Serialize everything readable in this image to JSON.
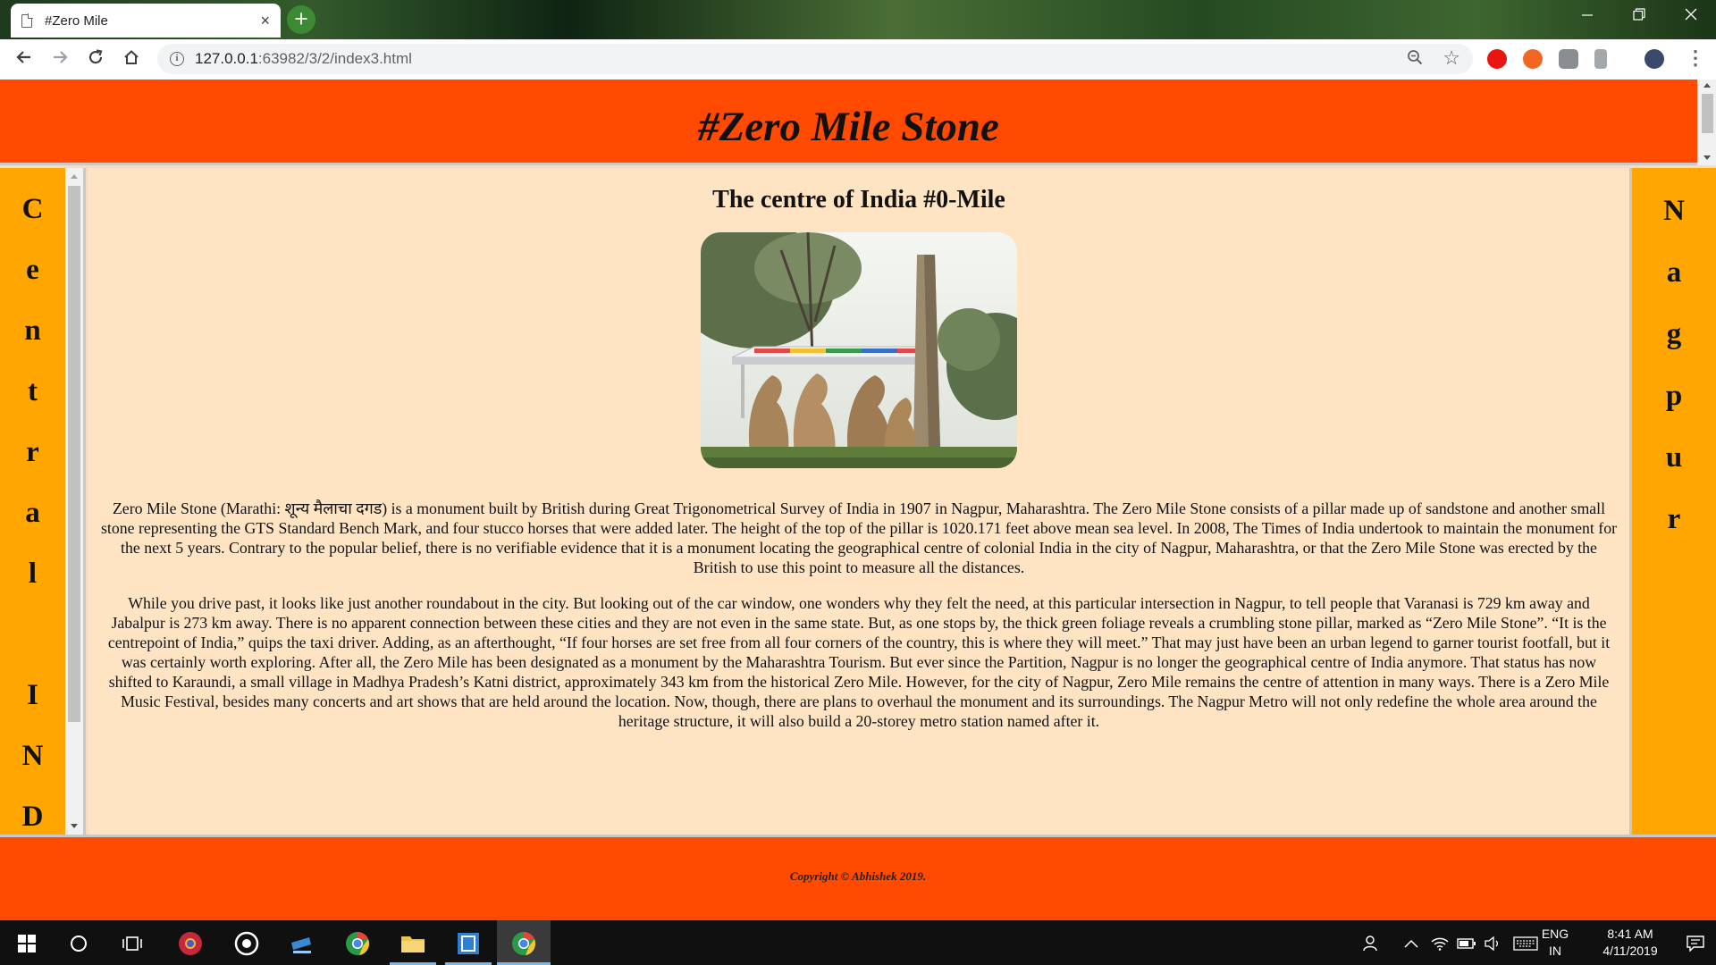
{
  "browser": {
    "tab_title": "#Zero Mile",
    "tab_close": "×",
    "new_tab": "+",
    "url_host": "127.0.0.1",
    "url_path": ":63982/3/2/index3.html",
    "accent": "#3c8a34"
  },
  "page": {
    "header_title": "#Zero Mile Stone",
    "left_sidebar_letters": [
      "C",
      "e",
      "n",
      "t",
      "r",
      "a",
      "l",
      "",
      "I",
      "N",
      "D"
    ],
    "right_sidebar_letters": [
      "N",
      "a",
      "g",
      "p",
      "u",
      "r"
    ],
    "main_heading": "The centre of India #0-Mile",
    "paragraph_1": "Zero Mile Stone (Marathi: शून्य मैलाचा दगड) is a monument built by British during Great Trigonometrical Survey of India in 1907 in Nagpur, Maharashtra. The Zero Mile Stone consists of a pillar made up of sandstone and another small stone representing the GTS Standard Bench Mark, and four stucco horses that were added later. The height of the top of the pillar is 1020.171 feet above mean sea level. In 2008, The Times of India undertook to maintain the monument for the next 5 years. Contrary to the popular belief, there is no verifiable evidence that it is a monument locating the geographical centre of colonial India in the city of Nagpur, Maharashtra, or that the Zero Mile Stone was erected by the British to use this point to measure all the distances.",
    "paragraph_2": "While you drive past, it looks like just another roundabout in the city. But looking out of the car window, one wonders why they felt the need, at this particular intersection in Nagpur, to tell people that Varanasi is 729 km away and Jabalpur is 273 km away. There is no apparent connection between these cities and they are not even in the same state. But, as one stops by, the thick green foliage reveals a crumbling stone pillar, marked as “Zero Mile Stone”. “It is the centrepoint of India,” quips the taxi driver. Adding, as an afterthought, “If four horses are set free from all four corners of the country, this is where they will meet.” That may just have been an urban legend to garner tourist footfall, but it was certainly worth exploring. After all, the Zero Mile has been designated as a monument by the Maharashtra Tourism. But ever since the Partition, Nagpur is no longer the geographical centre of India anymore. That status has now shifted to Karaundi, a small village in Madhya Pradesh’s Katni district, approximately 343 km from the historical Zero Mile. However, for the city of Nagpur, Zero Mile remains the centre of attention in many ways. There is a Zero Mile Music Festival, besides many concerts and art shows that are held around the location. Now, though, there are plans to overhaul the monument and its surroundings. The Nagpur Metro will not only redefine the whole area around the heritage structure, it will also build a 20-storey metro station named after it.",
    "footer_text": "Copyright © Abhishek 2019.",
    "colors": {
      "header": "#ff4a00",
      "sidebar": "#ffa600",
      "main_bg": "#ffe4c4"
    }
  },
  "taskbar": {
    "language_line1": "ENG",
    "language_line2": "IN",
    "time": "8:41 AM",
    "date": "4/11/2019"
  }
}
